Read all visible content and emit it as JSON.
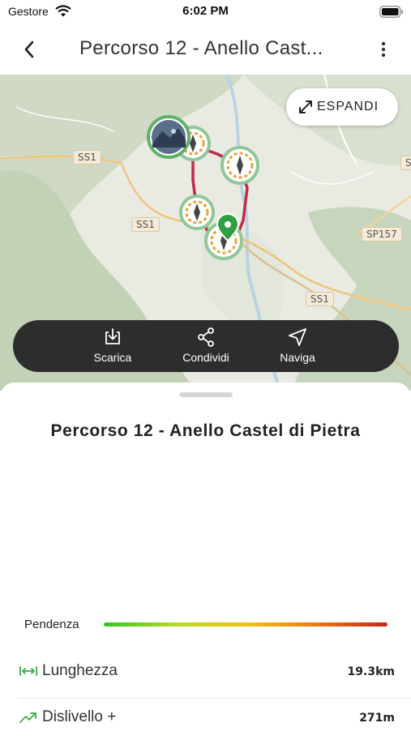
{
  "status_bar": {
    "carrier": "Gestore",
    "time": "6:02 PM"
  },
  "nav": {
    "title": "Percorso 12 - Anello Cast..."
  },
  "map": {
    "expand_label": "ESPANDI",
    "road_labels": {
      "ss1_a": "SS1",
      "ss1_b": "SS1",
      "ss1_c": "SS1",
      "sp157": "SP157",
      "edge": "S"
    },
    "route_color": "#c0294a",
    "start_pin_color": "#2f9e44"
  },
  "actions": {
    "download": "Scarica",
    "share": "Condividi",
    "navigate": "Naviga"
  },
  "sheet": {
    "title": "Percorso 12 - Anello Castel di Pietra",
    "slope_label": "Pendenza",
    "rows": [
      {
        "icon": "length-icon",
        "label": "Lunghezza",
        "value": "19.3km"
      },
      {
        "icon": "elevation-gain-icon",
        "label": "Dislivello +",
        "value": "271m"
      }
    ]
  }
}
